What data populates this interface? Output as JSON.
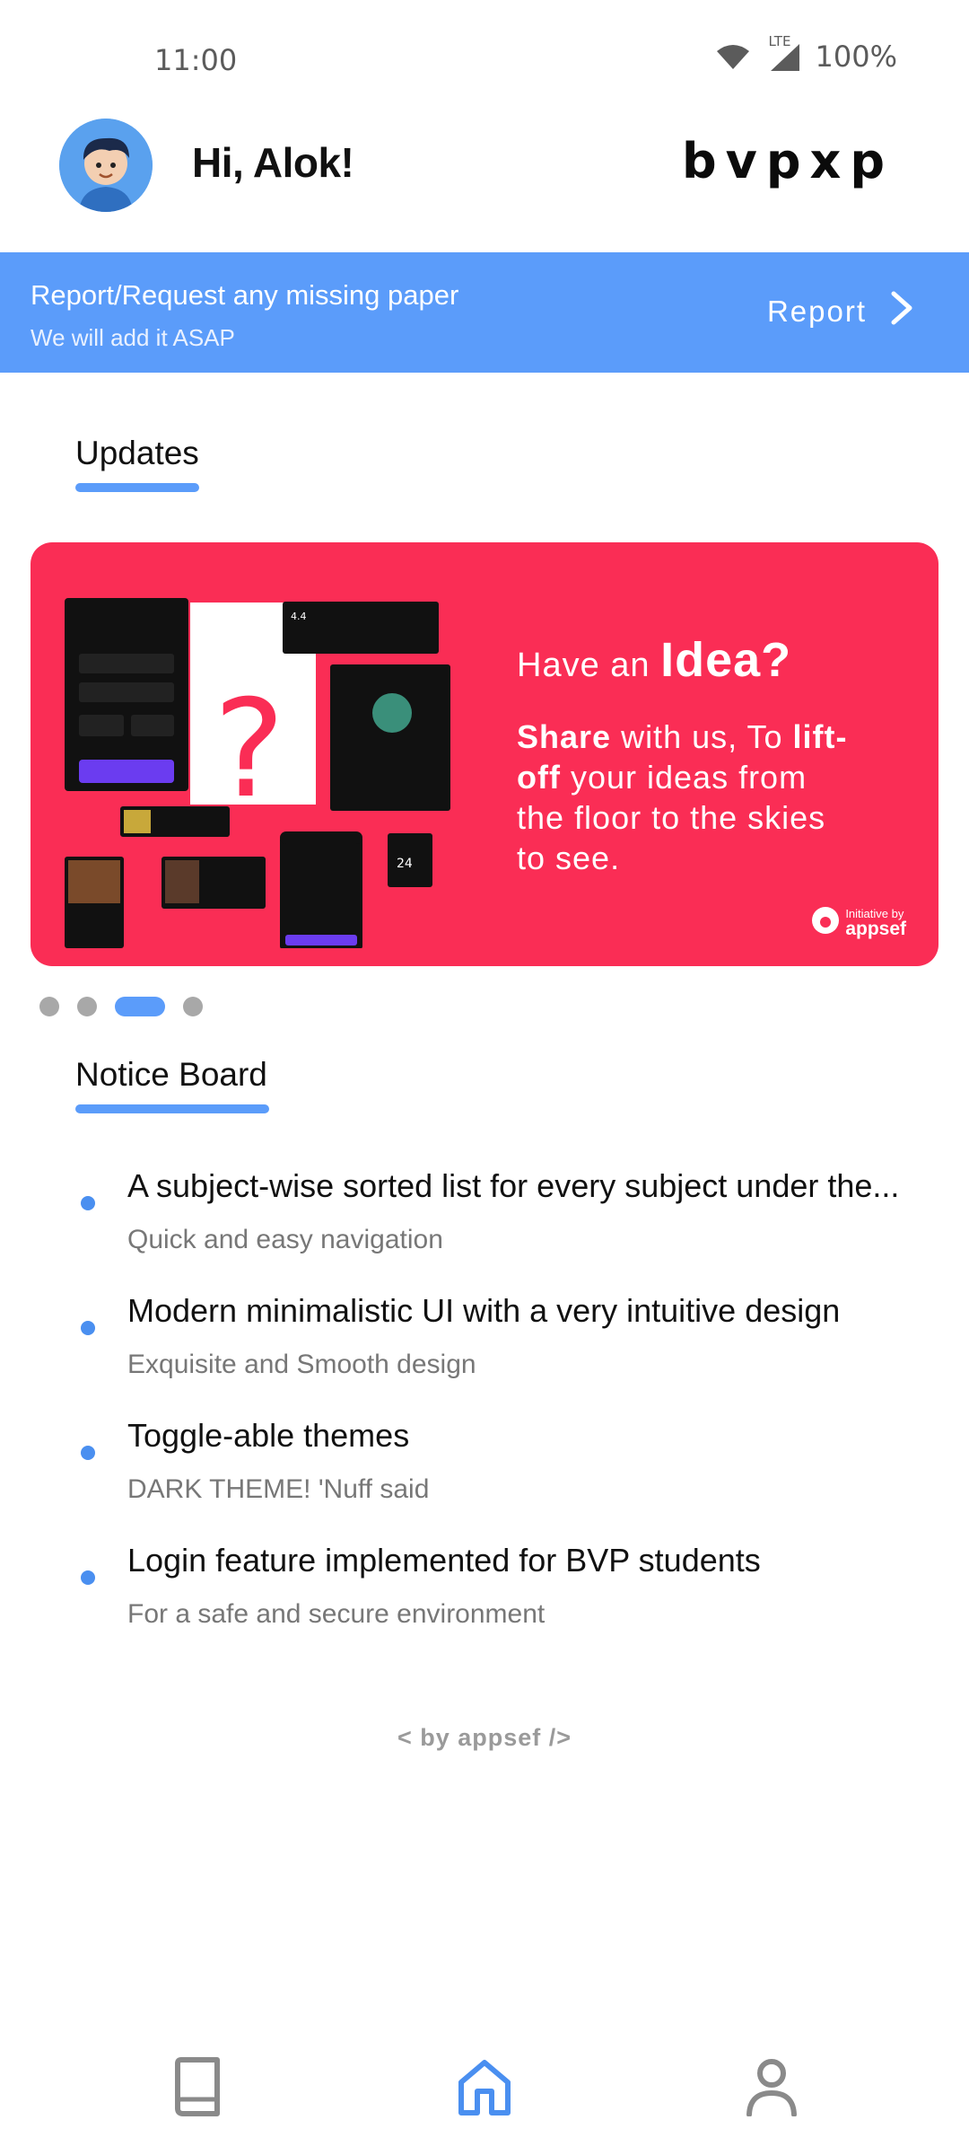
{
  "status_bar": {
    "time": "11:00",
    "network": "LTE",
    "battery": "100%",
    "icons": [
      "wifi-icon",
      "signal-icon"
    ]
  },
  "header": {
    "greeting": "Hi, Alok!",
    "logo": "bvpxp"
  },
  "report_banner": {
    "title": "Report/Request any missing paper",
    "subtitle": "We will add it ASAP",
    "action": "Report"
  },
  "updates": {
    "heading": "Updates",
    "slide": {
      "line1_prefix": "Have an",
      "line1_emphasis": "Idea?",
      "line2_bold1": "Share",
      "line2_rest1": " with us, To ",
      "line2_bold2": "lift-off",
      "line2_rest2": " your ideas from the floor to the skies to see.",
      "brand_small": "Initiative by",
      "brand_name": "appsef"
    },
    "page_index": 3,
    "page_count": 4
  },
  "notice_board": {
    "heading": "Notice Board",
    "items": [
      {
        "title": "A subject-wise sorted list for every subject under the...",
        "subtitle": "Quick and easy navigation"
      },
      {
        "title": "Modern minimalistic UI with a very intuitive design",
        "subtitle": "Exquisite and Smooth design"
      },
      {
        "title": "Toggle-able themes",
        "subtitle": "DARK THEME! 'Nuff said"
      },
      {
        "title": "Login feature implemented for BVP students",
        "subtitle": "For a safe and secure environment"
      }
    ]
  },
  "footer": "< by appsef />",
  "bottom_nav": {
    "items": [
      "book-icon",
      "home-icon",
      "profile-icon"
    ],
    "active": "home-icon"
  },
  "colors": {
    "accent": "#5b9cfa",
    "card": "#fa2d55",
    "text": "#111111",
    "muted": "#777777"
  }
}
